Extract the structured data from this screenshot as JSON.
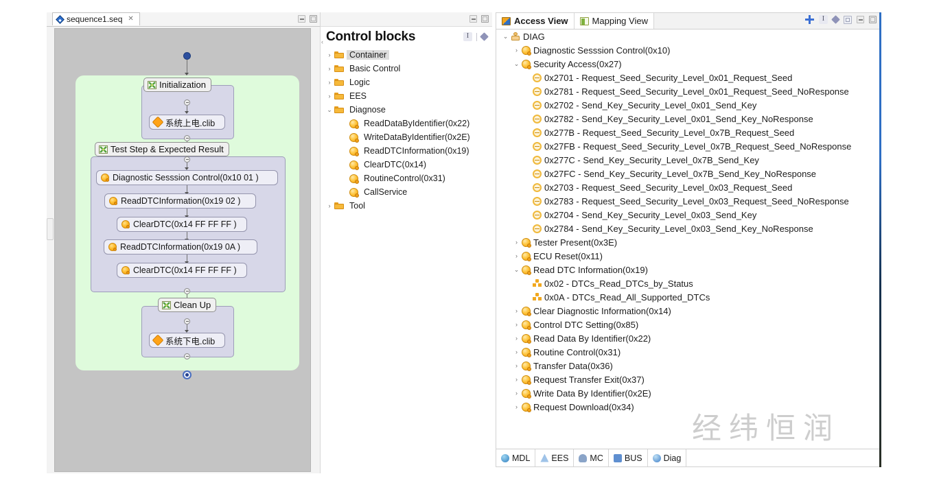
{
  "editor": {
    "tab": {
      "label": "sequence1.seq",
      "close_glyph": "✕",
      "icon": "diamond-blue-icon"
    },
    "diagram": {
      "start_node": "start-dot",
      "end_node": "end-dot",
      "groups": [
        {
          "title": "Initialization",
          "icon": "green-x-icon",
          "children": [
            {
              "label": "系统上电.clib",
              "icon": "orange-diamond-icon"
            }
          ]
        },
        {
          "title": "Test Step & Expected Result",
          "icon": "green-x-icon",
          "children": [
            {
              "label": "Diagnostic Sesssion Control(0x10 01 )",
              "icon": "orange-ball-icon"
            },
            {
              "label": "ReadDTCInformation(0x19 02 )",
              "icon": "orange-ball-icon"
            },
            {
              "label": "ClearDTC(0x14 FF FF FF )",
              "icon": "orange-ball-icon"
            },
            {
              "label": "ReadDTCInformation(0x19 0A )",
              "icon": "orange-ball-icon"
            },
            {
              "label": "ClearDTC(0x14 FF FF FF )",
              "icon": "orange-ball-icon"
            }
          ]
        },
        {
          "title": "Clean Up",
          "icon": "green-x-icon",
          "children": [
            {
              "label": "系统下电.clib",
              "icon": "orange-diamond-icon"
            }
          ]
        }
      ]
    }
  },
  "control_blocks": {
    "title": "Control blocks",
    "header_icons": [
      "i-view-icon",
      "diamond-dot-icon"
    ],
    "window_icons": [
      "minimize-icon",
      "maximize-icon"
    ],
    "tree": [
      {
        "label": "Container",
        "twisty": "›",
        "icon": "folder-icon",
        "indent": 0,
        "selected": true
      },
      {
        "label": "Basic Control",
        "twisty": "›",
        "icon": "folder-icon",
        "indent": 0,
        "selected": false
      },
      {
        "label": "Logic",
        "twisty": "›",
        "icon": "folder-icon",
        "indent": 0,
        "selected": false
      },
      {
        "label": "EES",
        "twisty": "›",
        "icon": "folder-icon",
        "indent": 0,
        "selected": false
      },
      {
        "label": "Diagnose",
        "twisty": "⌄",
        "icon": "folder-icon",
        "indent": 0,
        "selected": false
      },
      {
        "label": "ReadDataByIdentifier(0x22)",
        "twisty": "",
        "icon": "service-icon",
        "indent": 1,
        "selected": false
      },
      {
        "label": "WriteDataByIdentifier(0x2E)",
        "twisty": "",
        "icon": "service-icon",
        "indent": 1,
        "selected": false
      },
      {
        "label": "ReadDTCInformation(0x19)",
        "twisty": "",
        "icon": "service-icon",
        "indent": 1,
        "selected": false
      },
      {
        "label": "ClearDTC(0x14)",
        "twisty": "",
        "icon": "service-icon",
        "indent": 1,
        "selected": false
      },
      {
        "label": "RoutineControl(0x31)",
        "twisty": "",
        "icon": "service-icon",
        "indent": 1,
        "selected": false
      },
      {
        "label": "CallService",
        "twisty": "",
        "icon": "service-icon",
        "indent": 1,
        "selected": false
      },
      {
        "label": "Tool",
        "twisty": "›",
        "icon": "folder-icon",
        "indent": 0,
        "selected": false
      }
    ]
  },
  "right_panel": {
    "tabs": [
      {
        "label": "Access View",
        "icon": "access-view-icon",
        "active": true
      },
      {
        "label": "Mapping View",
        "icon": "mapping-view-icon",
        "active": false
      }
    ],
    "toolbar_icons": [
      "plus-icon",
      "i-view-icon",
      "diamond-dot-icon",
      "restore-icon",
      "minimize-icon",
      "maximize-icon"
    ],
    "tree": [
      {
        "label": "DIAG",
        "twisty": "⌄",
        "icon": "diag-root-icon",
        "indent": 0
      },
      {
        "label": "Diagnostic Sesssion Control(0x10)",
        "twisty": "›",
        "icon": "service-icon",
        "indent": 1
      },
      {
        "label": "Security Access(0x27)",
        "twisty": "⌄",
        "icon": "service-icon",
        "indent": 1
      },
      {
        "label": "0x2701 - Request_Seed_Security_Level_0x01_Request_Seed",
        "twisty": "",
        "icon": "subfunction-icon",
        "indent": 2
      },
      {
        "label": "0x2781 - Request_Seed_Security_Level_0x01_Request_Seed_NoResponse",
        "twisty": "",
        "icon": "subfunction-icon",
        "indent": 2
      },
      {
        "label": "0x2702 - Send_Key_Security_Level_0x01_Send_Key",
        "twisty": "",
        "icon": "subfunction-icon",
        "indent": 2
      },
      {
        "label": "0x2782 - Send_Key_Security_Level_0x01_Send_Key_NoResponse",
        "twisty": "",
        "icon": "subfunction-icon",
        "indent": 2
      },
      {
        "label": "0x277B - Request_Seed_Security_Level_0x7B_Request_Seed",
        "twisty": "",
        "icon": "subfunction-icon",
        "indent": 2
      },
      {
        "label": "0x27FB - Request_Seed_Security_Level_0x7B_Request_Seed_NoResponse",
        "twisty": "",
        "icon": "subfunction-icon",
        "indent": 2
      },
      {
        "label": "0x277C - Send_Key_Security_Level_0x7B_Send_Key",
        "twisty": "",
        "icon": "subfunction-icon",
        "indent": 2
      },
      {
        "label": "0x27FC - Send_Key_Security_Level_0x7B_Send_Key_NoResponse",
        "twisty": "",
        "icon": "subfunction-icon",
        "indent": 2
      },
      {
        "label": "0x2703 - Request_Seed_Security_Level_0x03_Request_Seed",
        "twisty": "",
        "icon": "subfunction-icon",
        "indent": 2
      },
      {
        "label": "0x2783 - Request_Seed_Security_Level_0x03_Request_Seed_NoResponse",
        "twisty": "",
        "icon": "subfunction-icon",
        "indent": 2
      },
      {
        "label": "0x2704 - Send_Key_Security_Level_0x03_Send_Key",
        "twisty": "",
        "icon": "subfunction-icon",
        "indent": 2
      },
      {
        "label": "0x2784 - Send_Key_Security_Level_0x03_Send_Key_NoResponse",
        "twisty": "",
        "icon": "subfunction-icon",
        "indent": 2
      },
      {
        "label": "Tester Present(0x3E)",
        "twisty": "›",
        "icon": "service-icon",
        "indent": 1
      },
      {
        "label": "ECU Reset(0x11)",
        "twisty": "›",
        "icon": "service-icon",
        "indent": 1
      },
      {
        "label": "Read DTC Information(0x19)",
        "twisty": "⌄",
        "icon": "service-icon",
        "indent": 1
      },
      {
        "label": "0x02 - DTCs_Read_DTCs_by_Status",
        "twisty": "",
        "icon": "dtc-icon",
        "indent": 2
      },
      {
        "label": "0x0A - DTCs_Read_All_Supported_DTCs",
        "twisty": "",
        "icon": "dtc-icon",
        "indent": 2
      },
      {
        "label": "Clear Diagnostic Information(0x14)",
        "twisty": "›",
        "icon": "service-icon",
        "indent": 1
      },
      {
        "label": "Control DTC Setting(0x85)",
        "twisty": "›",
        "icon": "service-icon",
        "indent": 1
      },
      {
        "label": "Read Data By Identifier(0x22)",
        "twisty": "›",
        "icon": "service-icon",
        "indent": 1
      },
      {
        "label": "Routine Control(0x31)",
        "twisty": "›",
        "icon": "service-icon",
        "indent": 1
      },
      {
        "label": "Transfer Data(0x36)",
        "twisty": "›",
        "icon": "service-icon",
        "indent": 1
      },
      {
        "label": "Request Transfer Exit(0x37)",
        "twisty": "›",
        "icon": "service-icon",
        "indent": 1
      },
      {
        "label": "Write Data By Identifier(0x2E)",
        "twisty": "›",
        "icon": "service-icon",
        "indent": 1
      },
      {
        "label": "Request Download(0x34)",
        "twisty": "›",
        "icon": "service-icon",
        "indent": 1
      }
    ],
    "status_tabs": [
      {
        "label": "MDL",
        "icon": "mdl-icon"
      },
      {
        "label": "EES",
        "icon": "ees-icon"
      },
      {
        "label": "MC",
        "icon": "mc-icon"
      },
      {
        "label": "BUS",
        "icon": "bus-icon"
      },
      {
        "label": "Diag",
        "icon": "diag-icon"
      }
    ]
  },
  "watermark": {
    "text": "经纬恒润"
  },
  "colors": {
    "canvas_bg": "#c4c4c4",
    "region_green": "#dffbdc",
    "group_lavender": "#d7d7e8",
    "node_fill": "#eeeef6",
    "accent_blue": "#3b6fd4",
    "icon_orange": "#f6b93b"
  }
}
